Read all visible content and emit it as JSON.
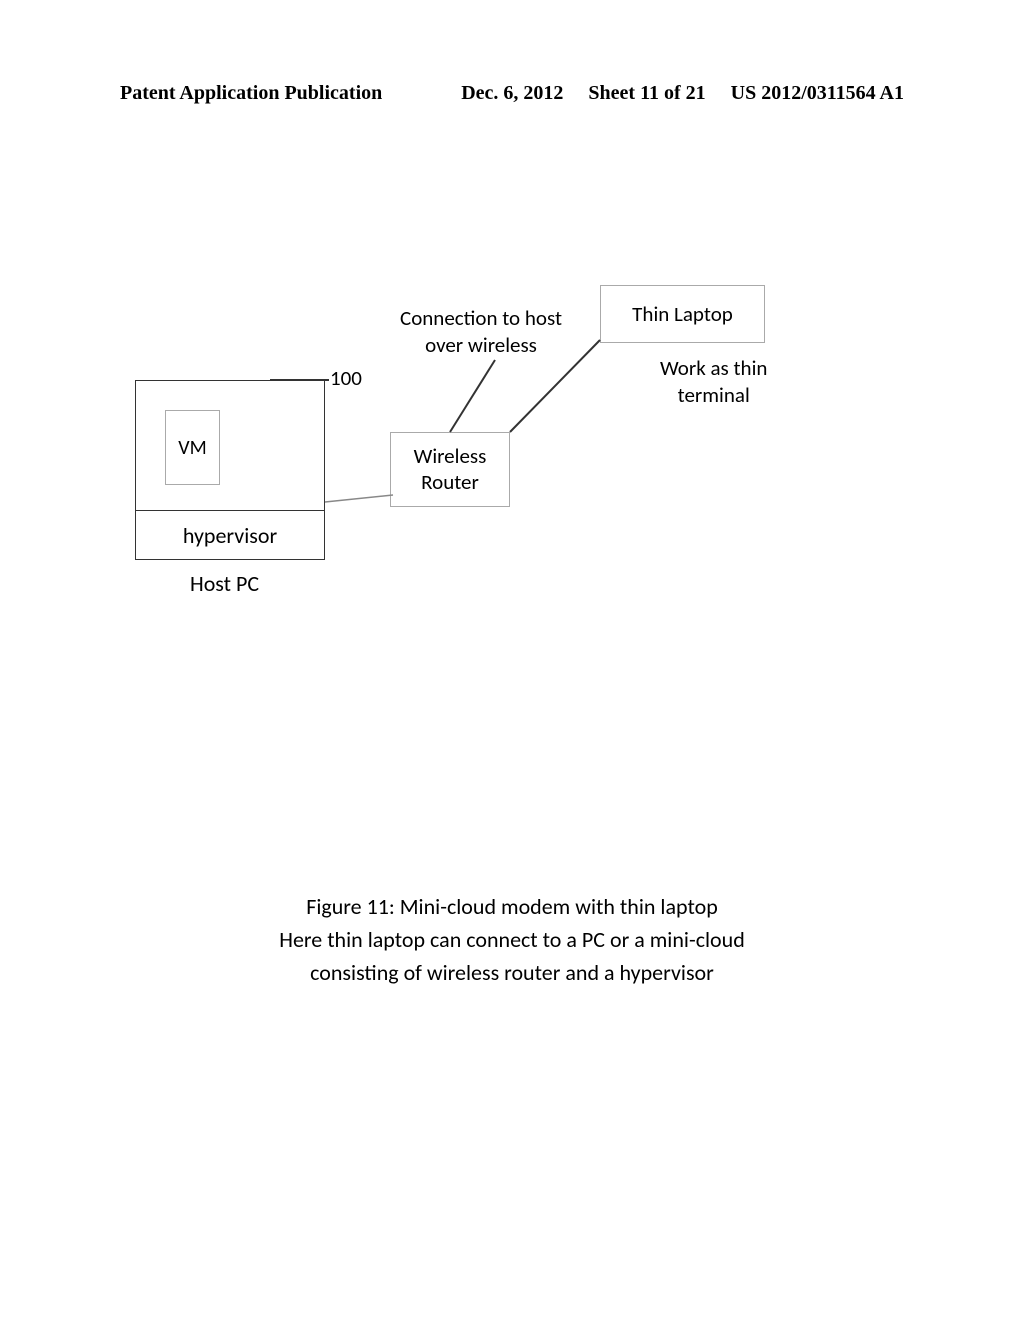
{
  "header": {
    "left": "Patent Application Publication",
    "date": "Dec. 6, 2012",
    "sheet": "Sheet 11 of 21",
    "pubnum": "US 2012/0311564 A1"
  },
  "diagram": {
    "vm": "VM",
    "hypervisor": "hypervisor",
    "host_pc": "Host PC",
    "wireless_router": "Wireless\nRouter",
    "thin_laptop": "Thin Laptop",
    "ref_100": "100",
    "connection_label": "Connection to host\nover wireless",
    "work_as_label": "Work as thin\nterminal"
  },
  "caption": {
    "line1": "Figure 11: Mini-cloud modem with thin laptop",
    "line2": "Here thin laptop can connect to a PC or a mini-cloud",
    "line3": "consisting of wireless router and a hypervisor"
  }
}
